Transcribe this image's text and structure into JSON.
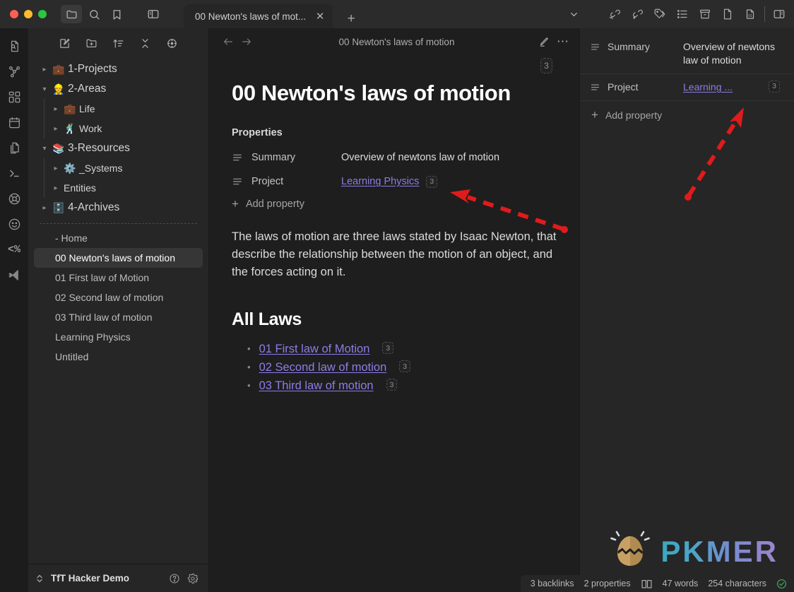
{
  "window": {
    "traffic_lights": [
      "close",
      "minimize",
      "maximize"
    ],
    "toolbar_icons": [
      "folder-icon",
      "search-icon",
      "bookmark-icon",
      "toggle-left-sidebar-icon"
    ],
    "right_toolbar_icons": [
      "backlinks-icon",
      "outgoing-links-icon",
      "tags-icon",
      "outline-icon",
      "archive-icon",
      "file-icon",
      "daily-note-icon",
      "toggle-right-sidebar-icon"
    ],
    "tab_overflow_icon": "chevron-down-icon"
  },
  "tabs": [
    {
      "title": "00 Newton's laws of mot...",
      "close_label": "✕",
      "active": true
    }
  ],
  "new_tab_label": "+",
  "ribbon": {
    "items": [
      {
        "name": "file-search-icon"
      },
      {
        "name": "graph-view-icon"
      },
      {
        "name": "canvas-icon"
      },
      {
        "name": "calendar-icon"
      },
      {
        "name": "copy-files-icon"
      },
      {
        "name": "terminal-icon"
      },
      {
        "name": "lifebuoy-icon"
      },
      {
        "name": "smiley-icon"
      },
      {
        "name": "templater-icon",
        "glyph": "<%"
      },
      {
        "name": "vscode-editor-icon"
      }
    ]
  },
  "sidebar": {
    "toolbar": [
      {
        "name": "new-note-button"
      },
      {
        "name": "new-folder-button"
      },
      {
        "name": "change-sort-order-button"
      },
      {
        "name": "collapse-all-button"
      },
      {
        "name": "reveal-active-file-button"
      }
    ],
    "tree": [
      {
        "label": "1-Projects",
        "emoji": "💼",
        "expanded": false,
        "depth": 0
      },
      {
        "label": "2-Areas",
        "emoji": "👷",
        "expanded": true,
        "depth": 0
      },
      {
        "label": "Life",
        "emoji": "💼",
        "expanded": false,
        "depth": 1
      },
      {
        "label": "Work",
        "emoji": "🕺",
        "expanded": false,
        "depth": 1
      },
      {
        "label": "3-Resources",
        "emoji": "📚",
        "expanded": true,
        "depth": 0
      },
      {
        "label": "_Systems",
        "emoji": "⚙️",
        "expanded": false,
        "depth": 1
      },
      {
        "label": "Entities",
        "emoji": "",
        "expanded": false,
        "depth": 1
      },
      {
        "label": "4-Archives",
        "emoji": "🗄️",
        "expanded": false,
        "depth": 0
      }
    ],
    "files": [
      {
        "label": "- Home",
        "selected": false
      },
      {
        "label": "00 Newton's laws of motion",
        "selected": true
      },
      {
        "label": "01 First law of Motion",
        "selected": false
      },
      {
        "label": "02 Second law of motion",
        "selected": false
      },
      {
        "label": "03 Third law of motion",
        "selected": false
      },
      {
        "label": "Learning Physics",
        "selected": false
      },
      {
        "label": "Untitled",
        "selected": false
      }
    ],
    "vault": {
      "name": "TfT Hacker Demo",
      "switcher_icon": "vault-switcher-icon",
      "help_icon": "help-icon",
      "settings_icon": "settings-gear-icon"
    }
  },
  "editor": {
    "back_label": "←",
    "forward_label": "→",
    "header_title": "00 Newton's laws of motion",
    "edit_icon": "pencil-icon",
    "more_icon": "more-options-icon",
    "title_backlink_count": "3",
    "note_title": "00 Newton's laws of motion",
    "properties_heading": "Properties",
    "properties": [
      {
        "key": "Summary",
        "value": "Overview of newtons law of motion",
        "type": "text",
        "icon": "text-property-icon"
      },
      {
        "key": "Project",
        "value": "Learning Physics",
        "type": "link",
        "badge": "3",
        "icon": "text-property-icon"
      }
    ],
    "add_property_label": "Add property",
    "paragraph": "The laws of motion are three laws stated by Isaac Newton, that describe the relationship between the motion of an object, and the forces acting on it.",
    "section_heading": "All Laws",
    "law_links": [
      {
        "label": "01 First law of Motion",
        "badge": "3"
      },
      {
        "label": "02 Second law of motion",
        "badge": "3"
      },
      {
        "label": "03 Third law of motion",
        "badge": "3"
      }
    ]
  },
  "right_panel": {
    "properties": [
      {
        "key": "Summary",
        "value": "Overview of newtons law of motion",
        "type": "text",
        "icon": "text-property-icon"
      },
      {
        "key": "Project",
        "value": "Learning ...",
        "type": "link",
        "badge": "3",
        "icon": "text-property-icon"
      }
    ],
    "add_property_label": "Add property"
  },
  "statusbar": {
    "backlinks": "3 backlinks",
    "properties": "2 properties",
    "reading_icon": "reading-view-icon",
    "words": "47 words",
    "characters": "254 characters",
    "sync_icon": "sync-ok-icon"
  },
  "watermark": {
    "text": "PKMER",
    "logo": "pkmer-egg-logo"
  },
  "annotations": {
    "arrows": [
      {
        "name": "arrow-to-editor-project-badge",
        "color": "#e01b1b"
      },
      {
        "name": "arrow-to-right-panel-project-badge",
        "color": "#e01b1b"
      }
    ]
  },
  "colors": {
    "accent_link": "#8e7ce6",
    "annotation_red": "#e01b1b",
    "sync_green": "#3fa45b",
    "bg_app": "#1e1e1e",
    "bg_sidebar": "#262626"
  }
}
